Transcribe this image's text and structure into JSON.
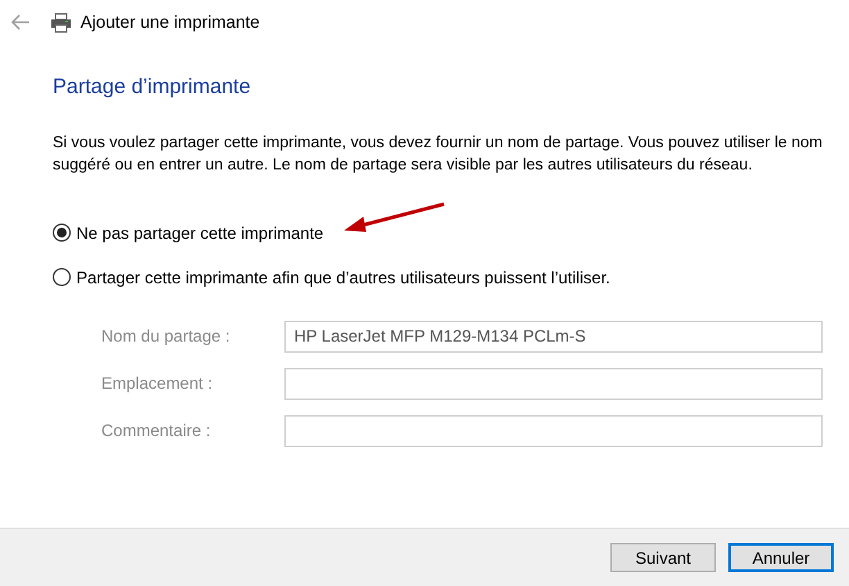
{
  "window": {
    "title": "Ajouter une imprimante"
  },
  "heading": "Partage d’imprimante",
  "description": "Si vous voulez partager cette imprimante, vous devez fournir un nom de partage. Vous pouvez utiliser le nom suggéré ou en entrer un autre. Le nom de partage sera visible par les autres utilisateurs du réseau.",
  "options": [
    {
      "label": "Ne pas partager cette imprimante",
      "selected": true,
      "annotated": true
    },
    {
      "label": "Partager cette imprimante afin que d’autres utilisateurs puissent l’utiliser.",
      "selected": false,
      "annotated": false
    }
  ],
  "fields": [
    {
      "label": "Nom du partage :",
      "value": "HP LaserJet MFP M129-M134 PCLm-S",
      "disabled": true
    },
    {
      "label": "Emplacement :",
      "disabled": true
    },
    {
      "label": "Commentaire :",
      "disabled": true
    }
  ],
  "buttons": [
    {
      "label": "Suivant",
      "focused": false
    },
    {
      "label": "Annuler",
      "focused": true
    }
  ]
}
